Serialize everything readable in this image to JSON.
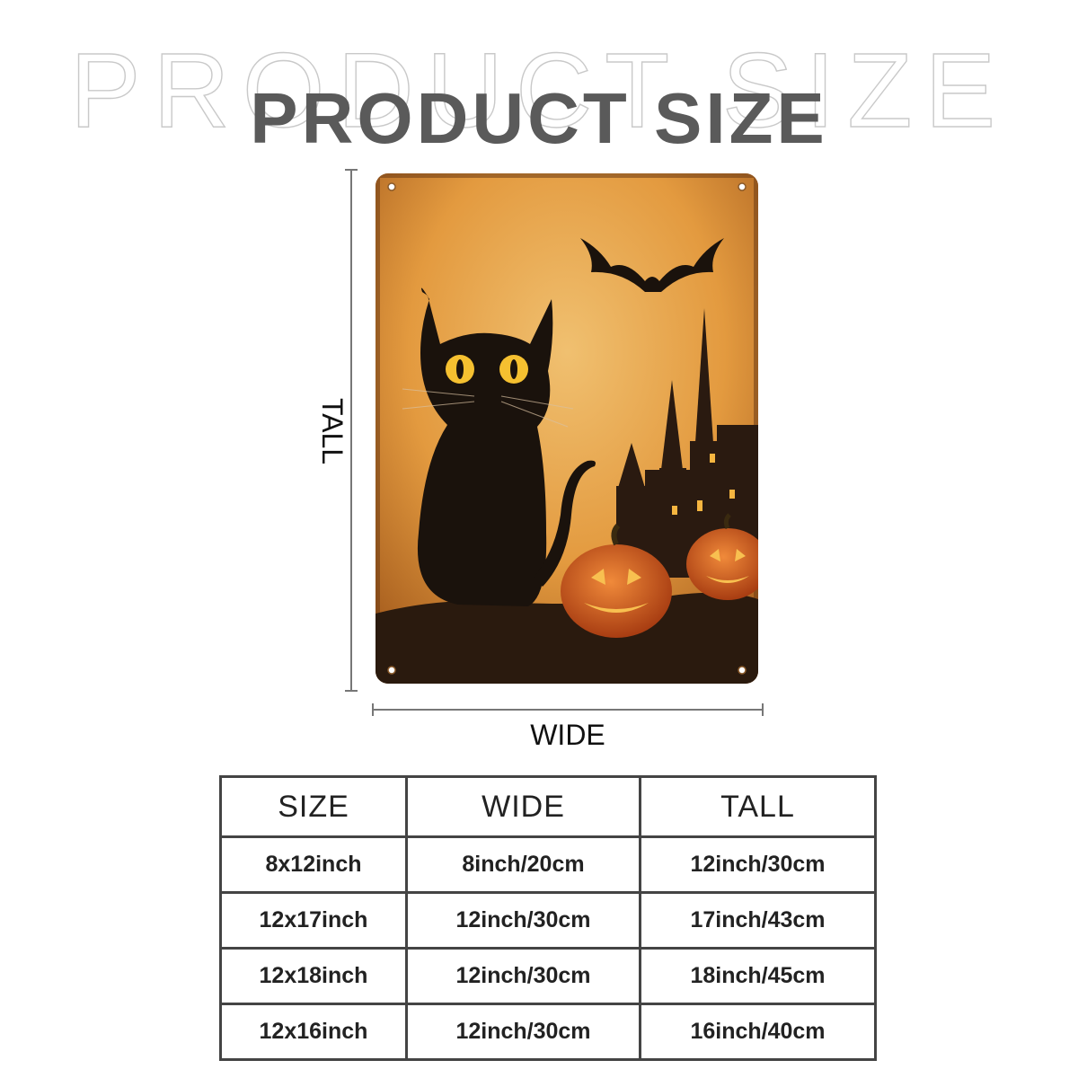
{
  "heading": {
    "ghost_text": "PRODUCT SIZE",
    "title": "PRODUCT SIZE"
  },
  "dimensions": {
    "tall_label": "TALL",
    "wide_label": "WIDE"
  },
  "artwork": {
    "description_icon": "black-cat-halloween-sign-icon",
    "colors": {
      "background": "#e8a64a",
      "cat": "#1a120c",
      "pumpkin": "#d8642a"
    }
  },
  "size_table": {
    "headers": [
      "SIZE",
      "WIDE",
      "TALL"
    ],
    "rows": [
      [
        "8x12inch",
        "8inch/20cm",
        "12inch/30cm"
      ],
      [
        "12x17inch",
        "12inch/30cm",
        "17inch/43cm"
      ],
      [
        "12x18inch",
        "12inch/30cm",
        "18inch/45cm"
      ],
      [
        "12x16inch",
        "12inch/30cm",
        "16inch/40cm"
      ]
    ]
  }
}
